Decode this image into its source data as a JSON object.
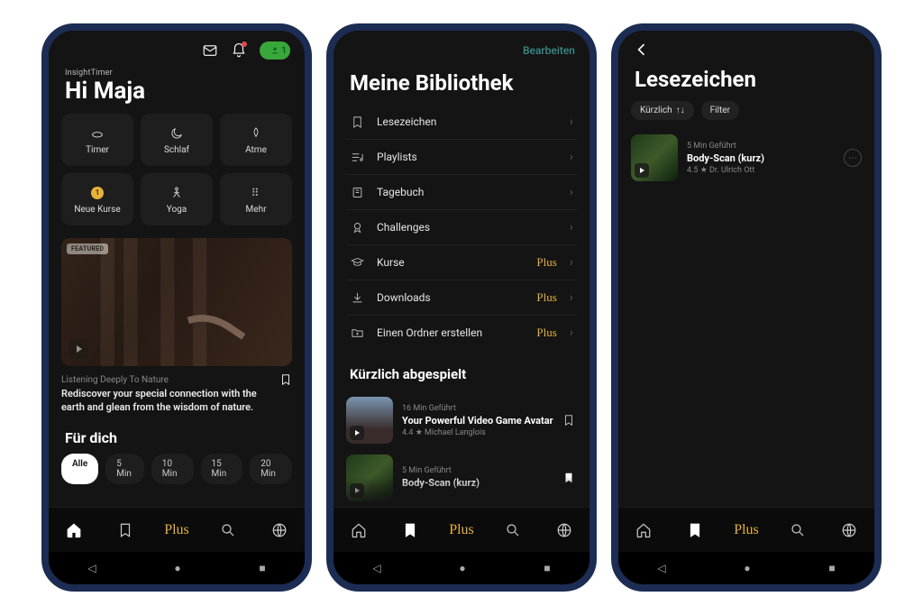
{
  "screen1": {
    "brand": "InsightTimer",
    "greeting": "Hi Maja",
    "avatar_count": "1",
    "tiles": [
      {
        "icon": "bowl",
        "label": "Timer"
      },
      {
        "icon": "moon",
        "label": "Schlaf"
      },
      {
        "icon": "leaf",
        "label": "Atme"
      },
      {
        "icon": "badge1",
        "label": "Neue Kurse"
      },
      {
        "icon": "yoga",
        "label": "Yoga"
      },
      {
        "icon": "more",
        "label": "Mehr"
      }
    ],
    "featured": {
      "badge": "FEATURED",
      "subtitle": "Listening Deeply To Nature",
      "description": "Rediscover your special connection with the earth and glean from the wisdom of nature."
    },
    "for_you_heading": "Für dich",
    "chips": [
      "Alle",
      "5 Min",
      "10 Min",
      "15 Min",
      "20 Min"
    ]
  },
  "screen2": {
    "edit_label": "Bearbeiten",
    "title": "Meine Bibliothek",
    "items": [
      {
        "icon": "bookmark",
        "label": "Lesezeichen",
        "plus": false
      },
      {
        "icon": "playlist",
        "label": "Playlists",
        "plus": false
      },
      {
        "icon": "journal",
        "label": "Tagebuch",
        "plus": false
      },
      {
        "icon": "trophy",
        "label": "Challenges",
        "plus": false
      },
      {
        "icon": "course",
        "label": "Kurse",
        "plus": true
      },
      {
        "icon": "download",
        "label": "Downloads",
        "plus": true
      },
      {
        "icon": "folder",
        "label": "Einen Ordner erstellen",
        "plus": true
      }
    ],
    "recent_heading": "Kürzlich abgespielt",
    "tracks": [
      {
        "meta": "16 Min Geführt",
        "title": "Your Powerful Video Game Avatar",
        "author": "4.4 ★ Michael Langlois",
        "bookmarked": false,
        "thumb": "avatar"
      },
      {
        "meta": "5 Min Geführt",
        "title": "Body-Scan (kurz)",
        "author": "",
        "bookmarked": true,
        "thumb": "forest"
      }
    ]
  },
  "screen3": {
    "title": "Lesezeichen",
    "sort_label": "Kürzlich",
    "filter_label": "Filter",
    "tracks": [
      {
        "meta": "5 Min Geführt",
        "title": "Body-Scan (kurz)",
        "author": "4.5 ★ Dr. Ulrich Ott",
        "thumb": "forest"
      }
    ]
  },
  "tabbar": {
    "plus_label": "Plus"
  }
}
